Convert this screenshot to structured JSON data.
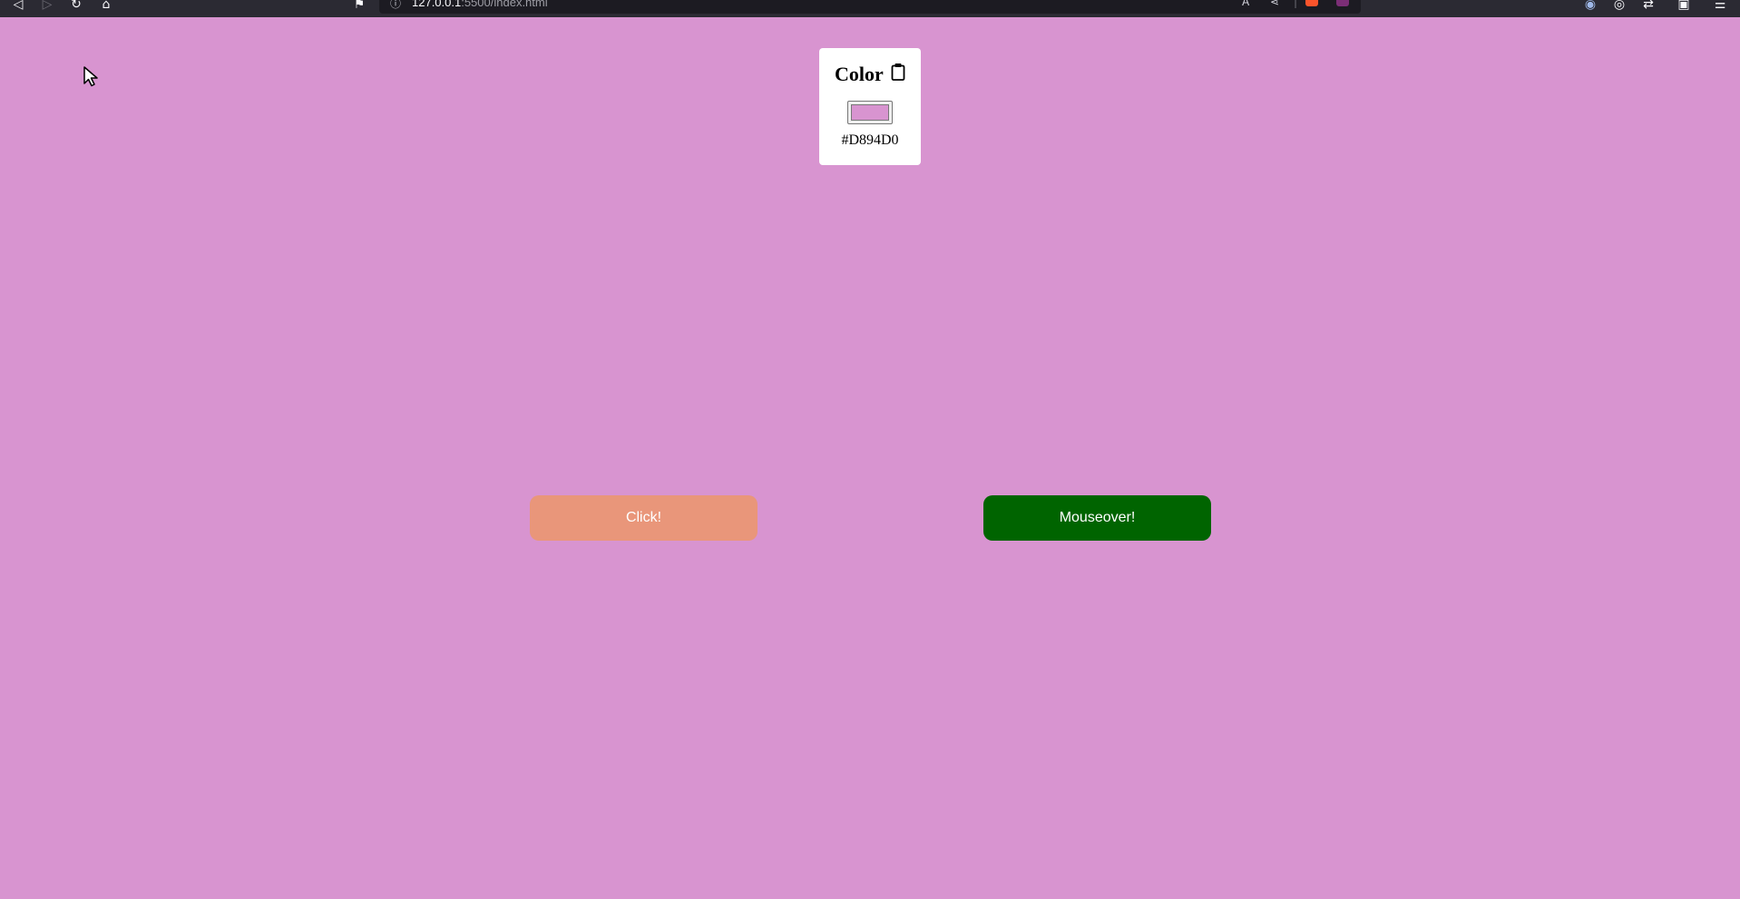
{
  "browser": {
    "url_host": "127.0.0.1",
    "url_rest": ":5500/index.html"
  },
  "card": {
    "title": "Color",
    "hex": "#D894D0",
    "swatch_color": "#d894d0"
  },
  "buttons": {
    "click_label": "Click!",
    "click_color": "#e9967a",
    "mouseover_label": "Mouseover!",
    "mouseover_color": "#006400"
  },
  "colors": {
    "page_background": "#d894d0",
    "card_background": "#ffffff",
    "toolbar_background": "#2b2a33"
  }
}
